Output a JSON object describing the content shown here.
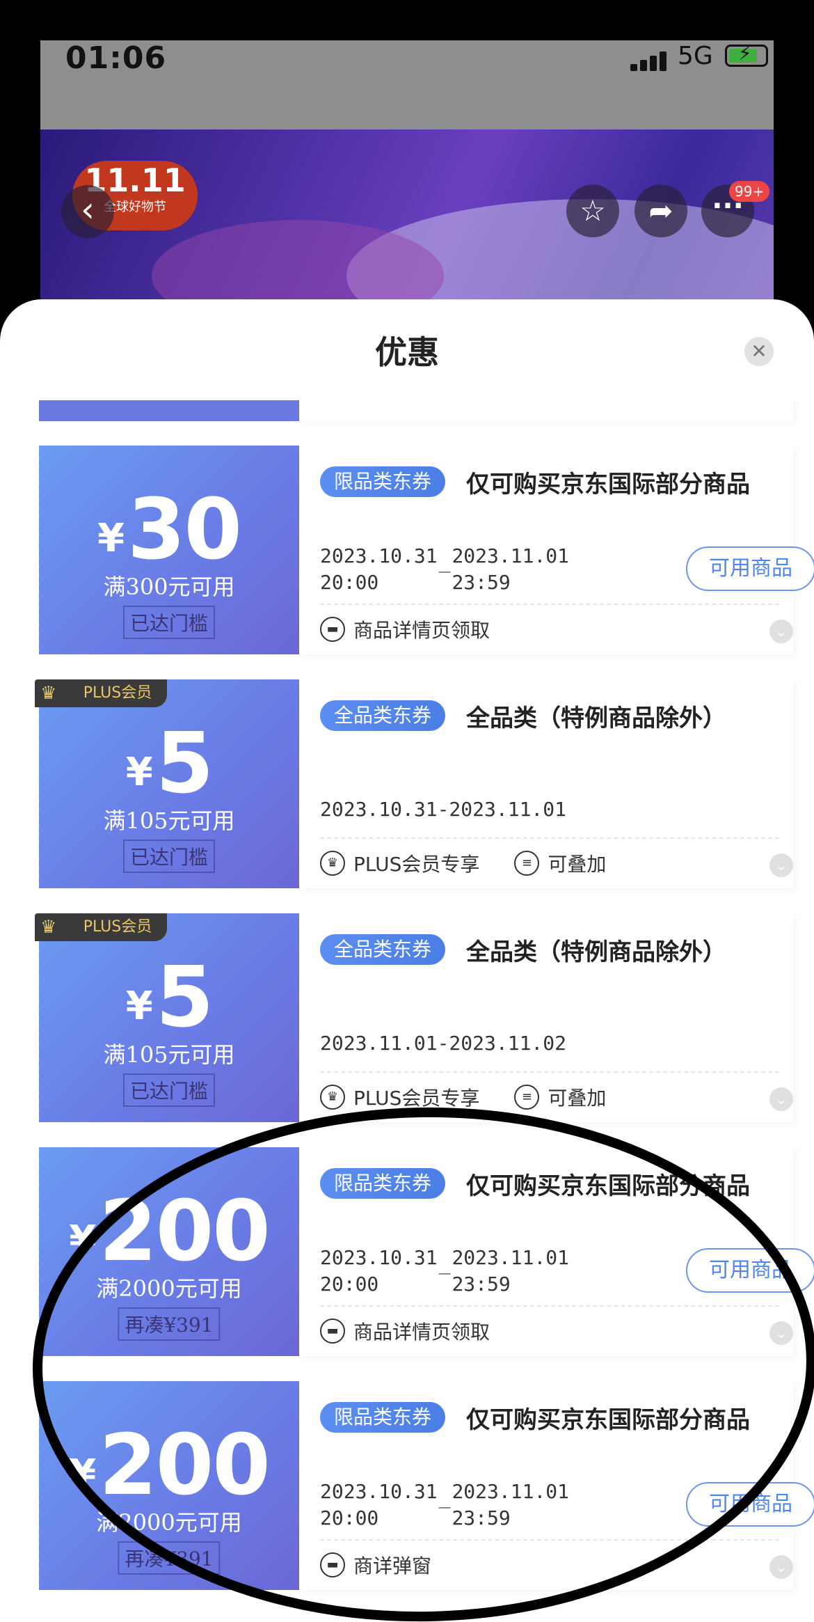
{
  "status_bar": {
    "time": "01:06",
    "network": "5G"
  },
  "banner": {
    "logo_line1": "11.11",
    "logo_line2": "全球好物节",
    "back_icon": "chevron-left-icon",
    "favorite_icon": "star-icon",
    "share_icon": "share-icon",
    "more_icon": "more-dots-icon",
    "message_badge": "99+"
  },
  "sheet": {
    "title": "优惠",
    "close_icon": "close-icon"
  },
  "coupons": [
    {
      "currency": "¥",
      "amount": "30",
      "condition": "满300元可用",
      "status": "已达门槛",
      "type_tag": "限品类东券",
      "description": "仅可购买京东国际部分商品",
      "start_date": "2023.10.31",
      "start_time": "20:00",
      "end_date": "2023.11.01",
      "end_time": "23:59",
      "action_label": "可用商品",
      "footer_items": [
        {
          "icon": "ticket-icon",
          "label": "商品详情页领取"
        }
      ]
    },
    {
      "ribbon": "PLUS会员",
      "currency": "¥",
      "amount": "5",
      "condition": "满105元可用",
      "status": "已达门槛",
      "type_tag": "全品类东券",
      "description": "全品类（特例商品除外）",
      "date_range": "2023.10.31-2023.11.01",
      "footer_items": [
        {
          "icon": "crown-icon",
          "label": "PLUS会员专享"
        },
        {
          "icon": "stack-icon",
          "label": "可叠加"
        }
      ]
    },
    {
      "ribbon": "PLUS会员",
      "currency": "¥",
      "amount": "5",
      "condition": "满105元可用",
      "status": "已达门槛",
      "type_tag": "全品类东券",
      "description": "全品类（特例商品除外）",
      "date_range": "2023.11.01-2023.11.02",
      "footer_items": [
        {
          "icon": "crown-icon",
          "label": "PLUS会员专享"
        },
        {
          "icon": "stack-icon",
          "label": "可叠加"
        }
      ]
    },
    {
      "currency": "¥",
      "amount": "200",
      "condition": "满2000元可用",
      "status": "再凑¥391",
      "type_tag": "限品类东券",
      "description": "仅可购买京东国际部分商品",
      "start_date": "2023.10.31",
      "start_time": "20:00",
      "end_date": "2023.11.01",
      "end_time": "23:59",
      "action_label": "可用商品",
      "footer_items": [
        {
          "icon": "ticket-icon",
          "label": "商品详情页领取"
        }
      ]
    },
    {
      "currency": "¥",
      "amount": "200",
      "condition": "满2000元可用",
      "status": "再凑¥391",
      "type_tag": "限品类东券",
      "description": "仅可购买京东国际部分商品",
      "start_date": "2023.10.31",
      "start_time": "20:00",
      "end_date": "2023.11.01",
      "end_time": "23:59",
      "action_label": "可用商品",
      "footer_items": [
        {
          "icon": "ticket-icon",
          "label": "商详弹窗"
        }
      ]
    }
  ],
  "colors": {
    "coupon_gradient_start": "#6b9cf2",
    "coupon_gradient_end": "#6b67d6",
    "accent_blue": "#4f86e8",
    "plus_gold": "#e9c56b",
    "annotation_stroke": "#000000"
  }
}
